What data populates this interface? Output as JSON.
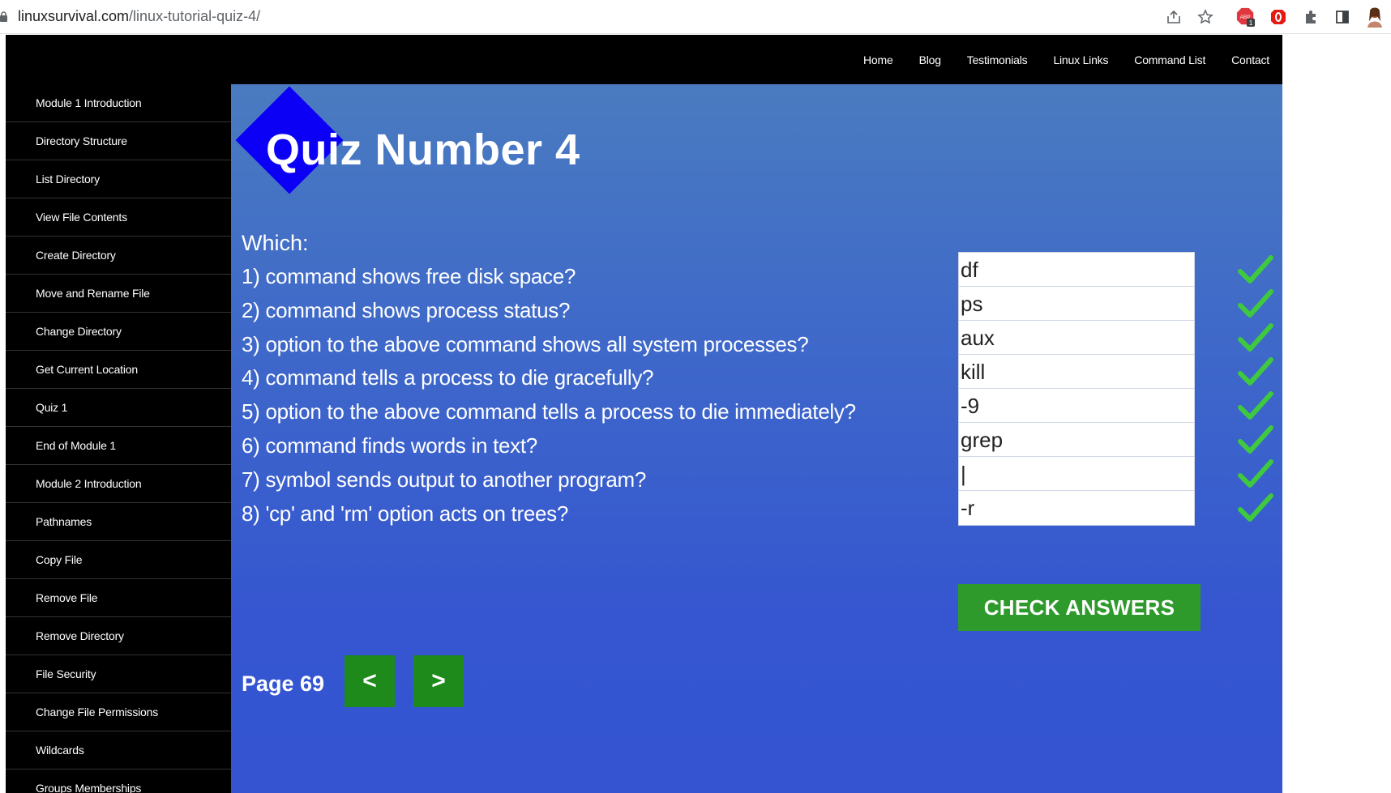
{
  "browser": {
    "url_domain": "linuxsurvival.com",
    "url_path": "/linux-tutorial-quiz-4/",
    "extension_badge_count": "1",
    "adblock_label": "ABP"
  },
  "topnav": {
    "items": [
      {
        "label": "Home"
      },
      {
        "label": "Blog"
      },
      {
        "label": "Testimonials"
      },
      {
        "label": "Linux Links"
      },
      {
        "label": "Command List"
      },
      {
        "label": "Contact"
      }
    ]
  },
  "sidebar": {
    "items": [
      {
        "label": "Module 1 Introduction"
      },
      {
        "label": "Directory Structure"
      },
      {
        "label": "List Directory"
      },
      {
        "label": "View File Contents"
      },
      {
        "label": "Create Directory"
      },
      {
        "label": "Move and Rename File"
      },
      {
        "label": "Change Directory"
      },
      {
        "label": "Get Current Location"
      },
      {
        "label": "Quiz 1"
      },
      {
        "label": "End of Module 1"
      },
      {
        "label": "Module 2 Introduction"
      },
      {
        "label": "Pathnames"
      },
      {
        "label": "Copy File"
      },
      {
        "label": "Remove File"
      },
      {
        "label": "Remove Directory"
      },
      {
        "label": "File Security"
      },
      {
        "label": "Change File Permissions"
      },
      {
        "label": "Wildcards"
      },
      {
        "label": "Groups Memberships"
      }
    ]
  },
  "quiz": {
    "title": "Quiz Number 4",
    "prompt": "Which:",
    "questions": [
      {
        "text": "1) command shows free disk space?",
        "answer": "df",
        "correct": true
      },
      {
        "text": "2) command shows process status?",
        "answer": "ps",
        "correct": true
      },
      {
        "text": "3) option to the above command shows all system processes?",
        "answer": "aux",
        "correct": true
      },
      {
        "text": "4) command tells a process to die gracefully?",
        "answer": "kill",
        "correct": true
      },
      {
        "text": "5) option to the above command tells a process to die immediately?",
        "answer": "-9",
        "correct": true
      },
      {
        "text": "6) command finds words in text?",
        "answer": "grep",
        "correct": true
      },
      {
        "text": "7) symbol sends output to another program?",
        "answer": "|",
        "correct": true
      },
      {
        "text": "8) 'cp' and 'rm' option acts on trees?",
        "answer": "-r",
        "correct": true
      }
    ],
    "check_button_label": "CHECK ANSWERS"
  },
  "pager": {
    "page_label": "Page 69",
    "prev_label": "<",
    "next_label": ">"
  },
  "colors": {
    "main_gradient_top": "#4a7bc0",
    "main_gradient_bottom": "#3454d2",
    "logo_diamond": "#0b00f5",
    "check_button": "#2e9a2b",
    "nav_button": "#1e8a1b",
    "checkmark": "#3ec93e"
  }
}
